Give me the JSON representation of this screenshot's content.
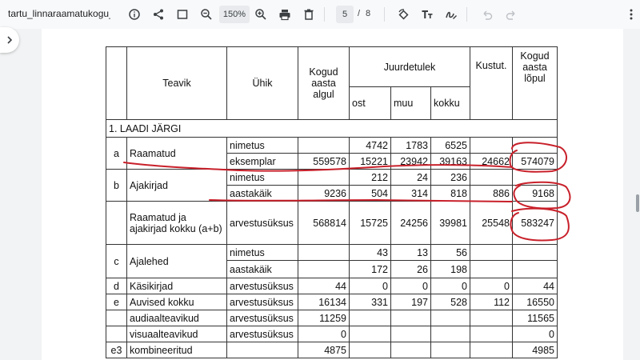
{
  "toolbar": {
    "doc_title": "tartu_linnaraamatukogu_a...",
    "zoom_value": "150%",
    "current_page": "5",
    "page_separator": "/",
    "total_pages": "8"
  },
  "table": {
    "headers": {
      "teavik": "Teavik",
      "uhik": "Ühik",
      "kogud_algul": "Kogud aasta algul",
      "juurdetulek": "Juurdetulek",
      "ost": "ost",
      "muu": "muu",
      "kokku": "kokku",
      "kustut": "Kustut.",
      "kogud_lopul": "Kogud aasta lõpul"
    },
    "section": "1. LAADI JÄRGI",
    "rows": [
      {
        "letter": "a",
        "name": "Raamatud",
        "sub": [
          {
            "unit": "nimetus",
            "alg": "",
            "ost": "4742",
            "muu": "1783",
            "kokku": "6525",
            "kust": "",
            "lop": ""
          },
          {
            "unit": "eksemplar",
            "alg": "559578",
            "ost": "15221",
            "muu": "23942",
            "kokku": "39163",
            "kust": "24662",
            "lop": "574079"
          }
        ]
      },
      {
        "letter": "b",
        "name": "Ajakirjad",
        "sub": [
          {
            "unit": "nimetus",
            "alg": "",
            "ost": "212",
            "muu": "24",
            "kokku": "236",
            "kust": "",
            "lop": ""
          },
          {
            "unit": "aastakäik",
            "alg": "9236",
            "ost": "504",
            "muu": "314",
            "kokku": "818",
            "kust": "886",
            "lop": "9168"
          }
        ]
      },
      {
        "letter": "",
        "name": "Raamatud ja ajakirjad kokku (a+b)",
        "sub": [
          {
            "unit": "arvestusüksus",
            "alg": "568814",
            "ost": "15725",
            "muu": "24256",
            "kokku": "39981",
            "kust": "25548",
            "lop": "583247"
          }
        ]
      },
      {
        "letter": "c",
        "name": "Ajalehed",
        "sub": [
          {
            "unit": "nimetus",
            "alg": "",
            "ost": "43",
            "muu": "13",
            "kokku": "56",
            "kust": "",
            "lop": ""
          },
          {
            "unit": "aastakäik",
            "alg": "",
            "ost": "172",
            "muu": "26",
            "kokku": "198",
            "kust": "",
            "lop": ""
          }
        ]
      },
      {
        "letter": "d",
        "name": "Käsikirjad",
        "sub": [
          {
            "unit": "arvestusüksus",
            "alg": "44",
            "ost": "0",
            "muu": "0",
            "kokku": "0",
            "kust": "0",
            "lop": "44"
          }
        ]
      },
      {
        "letter": "e",
        "name": "Auvised kokku",
        "sub": [
          {
            "unit": "arvestusüksus",
            "alg": "16134",
            "ost": "331",
            "muu": "197",
            "kokku": "528",
            "kust": "112",
            "lop": "16550"
          }
        ]
      },
      {
        "letter": "",
        "name": "audiaalteavikud",
        "sub": [
          {
            "unit": "arvestusüksus",
            "alg": "11259",
            "ost": "",
            "muu": "",
            "kokku": "",
            "kust": "",
            "lop": "11565"
          }
        ]
      },
      {
        "letter": "",
        "name": "visuaalteavikud",
        "sub": [
          {
            "unit": "arvestusüksus",
            "alg": "0",
            "ost": "",
            "muu": "",
            "kokku": "",
            "kust": "",
            "lop": "0"
          }
        ]
      },
      {
        "letter": "e3",
        "name": "kombineeritud",
        "sub": [
          {
            "unit": "",
            "alg": "4875",
            "ost": "",
            "muu": "",
            "kokku": "",
            "kust": "",
            "lop": "4985"
          }
        ]
      }
    ]
  },
  "annotation_color": "#c8202a"
}
